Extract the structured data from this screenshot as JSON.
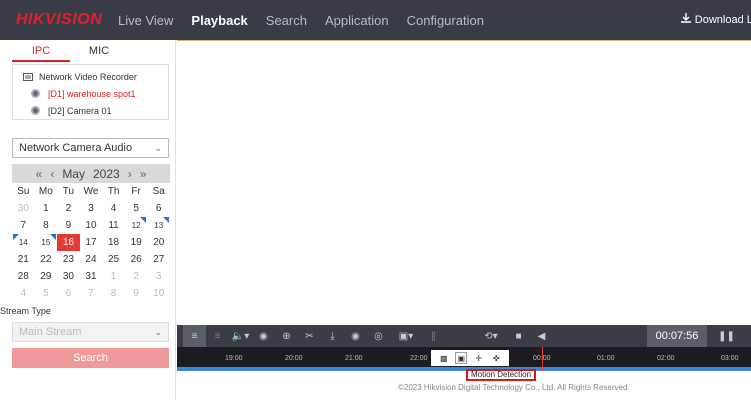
{
  "header": {
    "logo": "HIKVISION",
    "nav": [
      "Live View",
      "Playback",
      "Search",
      "Application",
      "Configuration"
    ],
    "active_nav": "Playback",
    "download_label": "Download Lo"
  },
  "sidebar": {
    "tabs": [
      "IPC",
      "MIC"
    ],
    "devices": {
      "root": "Network Video Recorder",
      "cameras": [
        "[D1] warehouse spot1",
        "[D2] Camera 01"
      ]
    },
    "audio_select": "Network Camera Audio",
    "calendar": {
      "month": "May",
      "year": "2023",
      "weekdays": [
        "Su",
        "Mo",
        "Tu",
        "We",
        "Th",
        "Fr",
        "Sa"
      ],
      "days": [
        "30",
        "1",
        "2",
        "3",
        "4",
        "5",
        "6",
        "7",
        "8",
        "9",
        "10",
        "11",
        "12",
        "13",
        "14",
        "15",
        "16",
        "17",
        "18",
        "19",
        "20",
        "21",
        "22",
        "23",
        "24",
        "25",
        "26",
        "27",
        "28",
        "29",
        "30",
        "31",
        "1",
        "2",
        "3",
        "4",
        "5",
        "6",
        "7",
        "8",
        "9",
        "10"
      ],
      "muted_indices": [
        0,
        32,
        33,
        34,
        35,
        36,
        37,
        38,
        39,
        40,
        41
      ],
      "selected_index": 16,
      "flagged_indices": [
        12,
        13,
        14,
        15
      ]
    },
    "stream_type_label": "Stream Type",
    "stream_select": "Main Stream",
    "search_button": "Search"
  },
  "playback": {
    "time": "00:07:56",
    "timeline_ticks": [
      "19:00",
      "20:00",
      "21:00",
      "22:00",
      "00:00",
      "01:00",
      "02:00",
      "03:00"
    ],
    "popup_label": "Motion Detection"
  },
  "footer": "©2023 Hikvision Digital Technology Co., Ltd. All Rights Reserved.",
  "colors": {
    "accent": "#e02020",
    "topbar": "#393c44",
    "toolbar": "#3a3d45",
    "timeline_bar": "#3b8ad9"
  }
}
